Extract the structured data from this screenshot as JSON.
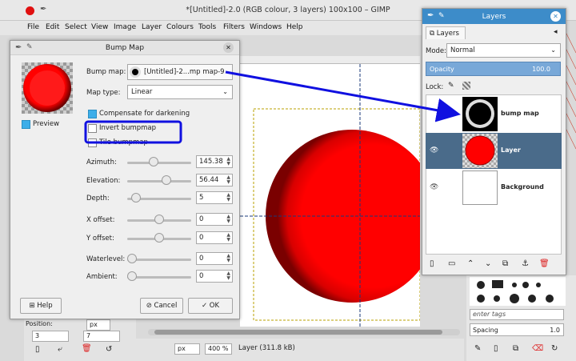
{
  "app": {
    "title": "*[Untitled]-2.0 (RGB colour, 3 layers) 100x100 – GIMP",
    "menu": [
      "File",
      "Edit",
      "Select",
      "View",
      "Image",
      "Layer",
      "Colours",
      "Tools",
      "Filters",
      "Windows",
      "Help"
    ]
  },
  "dialog": {
    "title": "Bump Map",
    "preview_label": "Preview",
    "bump_map_label": "Bump map:",
    "bump_map_value": "[Untitled]-2...mp map-9",
    "map_type_label": "Map type:",
    "map_type_value": "Linear",
    "compensate_label": "Compensate for darkening",
    "invert_label": "Invert bumpmap",
    "tile_label": "Tile bumpmap",
    "azimuth_label": "Azimuth:",
    "azimuth_value": "145.38",
    "elevation_label": "Elevation:",
    "elevation_value": "56.44",
    "depth_label": "Depth:",
    "depth_value": "5",
    "xoffset_label": "X offset:",
    "xoffset_value": "0",
    "yoffset_label": "Y offset:",
    "yoffset_value": "0",
    "waterlevel_label": "Waterlevel:",
    "waterlevel_value": "0",
    "ambient_label": "Ambient:",
    "ambient_value": "0",
    "help_label": "Help",
    "cancel_label": "Cancel",
    "ok_label": "OK",
    "sliders": {
      "azimuth": 0.4,
      "elevation": 0.63,
      "depth": 0.07,
      "xoffset": 0.5,
      "yoffset": 0.5,
      "waterlevel": 0.0,
      "ambient": 0.0
    }
  },
  "layers_panel": {
    "title": "Layers",
    "tab_label": "Layers",
    "mode_label": "Mode:",
    "mode_value": "Normal",
    "opacity_label": "Opacity",
    "opacity_value": "100.0",
    "lock_label": "Lock:",
    "layers": [
      {
        "name": "bump map"
      },
      {
        "name": "Layer"
      },
      {
        "name": "Background"
      }
    ]
  },
  "statusbar": {
    "unit": "px",
    "zoom": "400 %",
    "status": "Layer (311.8 kB)"
  },
  "left_dock": {
    "position_label": "Position:",
    "position_unit": "px",
    "field_a": "3",
    "field_b": "7"
  },
  "right_dock": {
    "tags_placeholder": "enter tags",
    "spacing_label": "Spacing",
    "spacing_value": "1.0"
  },
  "colors": {
    "accent": "#3daee9",
    "annotation_blue": "#1010e0",
    "red": "#ff0000",
    "layer_selected": "#4a6b8a"
  }
}
